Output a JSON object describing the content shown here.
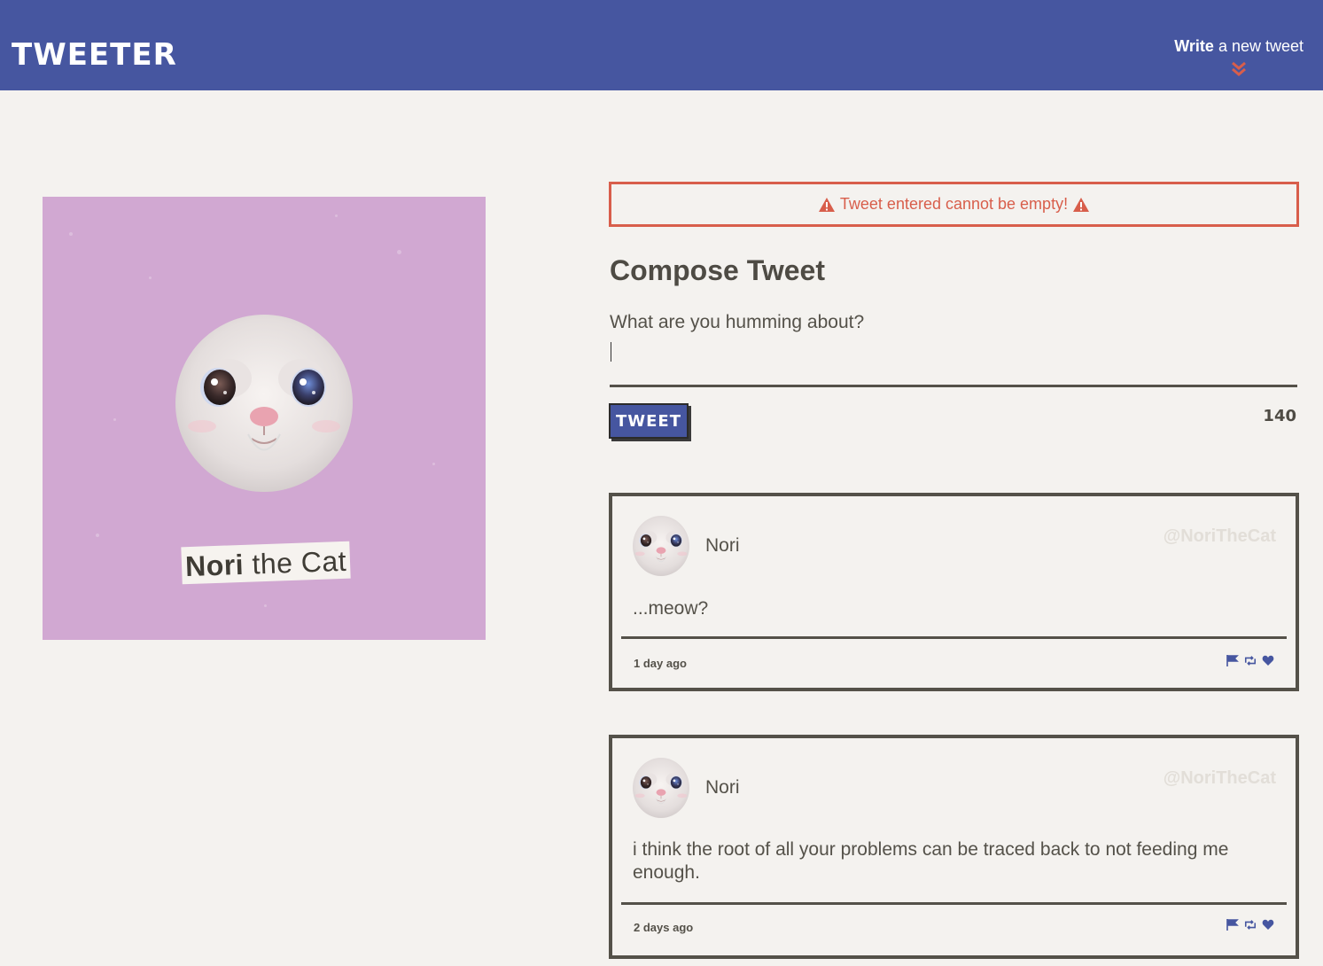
{
  "nav": {
    "brand": "TWEETER",
    "write_bold": "Write",
    "write_rest": " a new tweet"
  },
  "profile": {
    "first_name": "Nori",
    "rest_name": " the Cat"
  },
  "error": {
    "message": "Tweet entered cannot be empty!"
  },
  "compose": {
    "title": "Compose Tweet",
    "placeholder": "What are you humming about?",
    "button_label": "TWEET",
    "counter": "140"
  },
  "tweets": [
    {
      "name": "Nori",
      "handle": "@NoriTheCat",
      "text": "...meow?",
      "time": "1 day ago"
    },
    {
      "name": "Nori",
      "handle": "@NoriTheCat",
      "text": "i think the root of all your problems can be traced back to not feeding me enough.",
      "time": "2 days ago"
    }
  ],
  "colors": {
    "nav": "#4656a0",
    "error": "#d85e4b",
    "text": "#545149",
    "background": "#f4f2ef",
    "profile_bg": "#d1a8d2"
  }
}
